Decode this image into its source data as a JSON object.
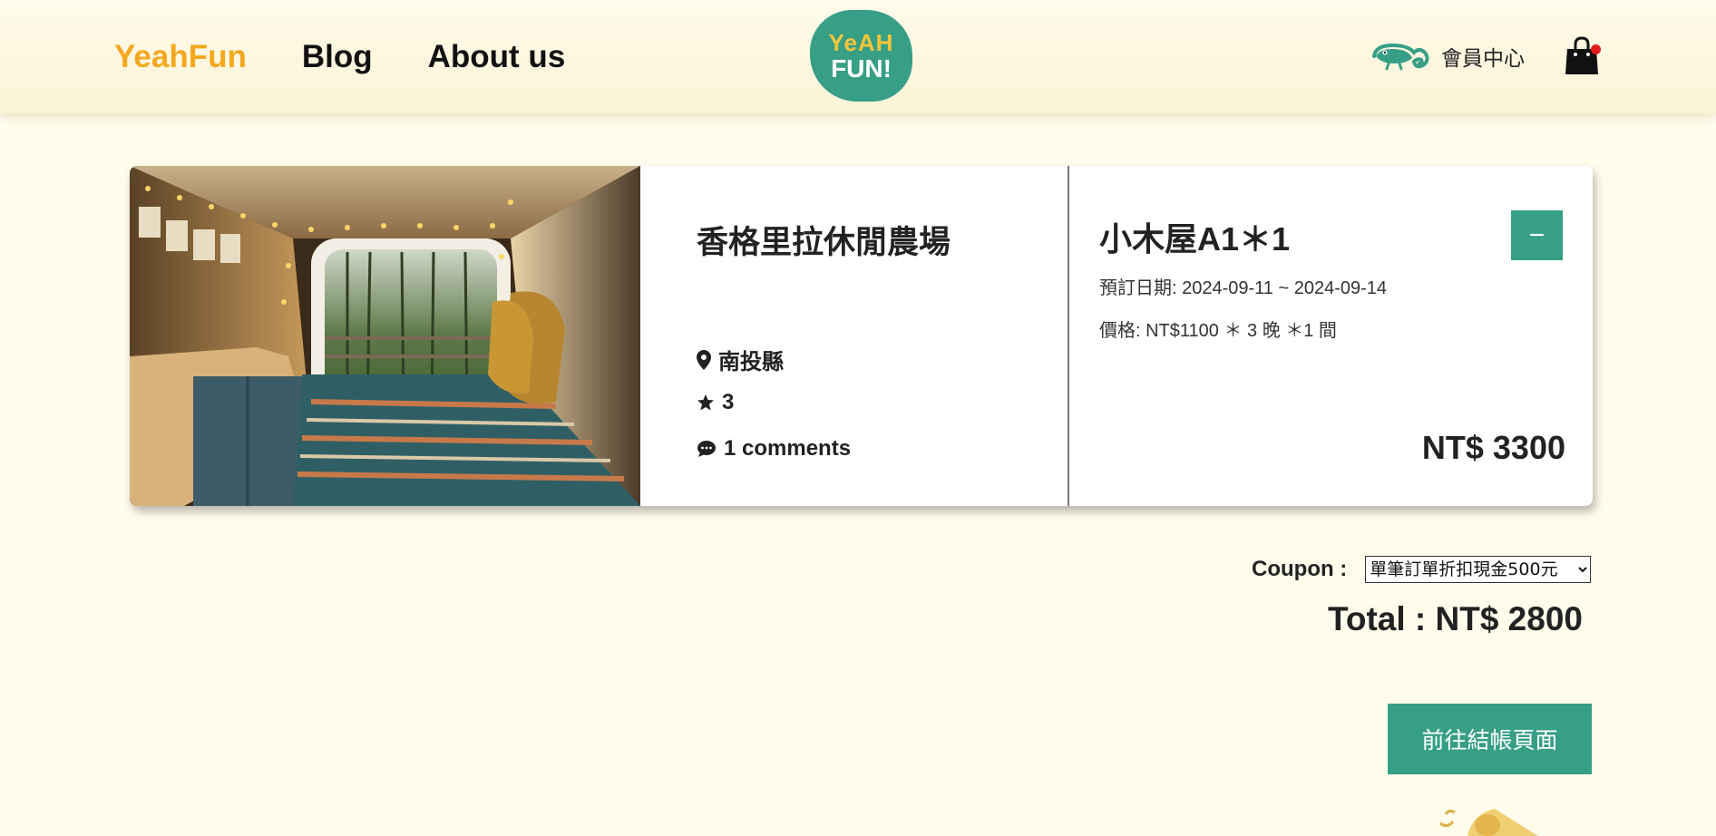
{
  "header": {
    "nav": [
      {
        "label": "YeahFun"
      },
      {
        "label": "Blog"
      },
      {
        "label": "About us"
      }
    ],
    "logo_line1": "YeAH",
    "logo_line2": "FUN!",
    "member_label": "會員中心"
  },
  "cart_item": {
    "farm_name": "香格里拉休閒農場",
    "location": "南投縣",
    "rating": "3",
    "comments": "1 comments",
    "room": "小木屋A1＊1",
    "dates": "預訂日期: 2024-09-11 ~ 2024-09-14",
    "price_detail": "價格: NT$1100 ＊ 3 晚 ＊1 間",
    "remove_label": "−",
    "subtotal": "NT$ 3300"
  },
  "coupon": {
    "label": "Coupon :",
    "selected": "單筆訂單折扣現金500元"
  },
  "total": "Total : NT$ 2800",
  "checkout_label": "前往結帳頁面",
  "colors": {
    "accent": "#369f86",
    "brand": "#f5a81f",
    "background": "#fffcec"
  }
}
